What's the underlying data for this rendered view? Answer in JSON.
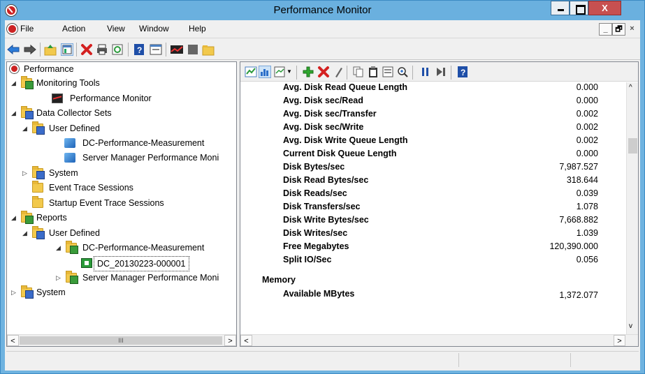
{
  "window": {
    "title": "Performance Monitor",
    "close_label": "X"
  },
  "menu": {
    "items": [
      "File",
      "Action",
      "View",
      "Window",
      "Help"
    ],
    "mdi": {
      "minimize": "_",
      "restore": "🗗",
      "close": "×"
    }
  },
  "toolbar": {
    "icons": [
      "back-arrow-icon",
      "forward-arrow-icon",
      "up-folder-icon",
      "show-hide-console-tree-icon",
      "delete-icon",
      "print-icon",
      "refresh-icon",
      "help-icon",
      "properties-icon",
      "performance-chart-icon",
      "stop-icon",
      "new-folder-icon"
    ]
  },
  "tree": {
    "root": "Performance",
    "nodes": [
      {
        "label": "Monitoring Tools"
      },
      {
        "label": "Performance Monitor"
      },
      {
        "label": "Data Collector Sets"
      },
      {
        "label": "User Defined"
      },
      {
        "label": "DC-Performance-Measurement"
      },
      {
        "label": "Server Manager Performance Moni"
      },
      {
        "label": "System"
      },
      {
        "label": "Event Trace Sessions"
      },
      {
        "label": "Startup Event Trace Sessions"
      },
      {
        "label": "Reports"
      },
      {
        "label": "User Defined"
      },
      {
        "label": "DC-Performance-Measurement"
      },
      {
        "label": "DC_20130223-000001"
      },
      {
        "label": "Server Manager Performance Moni"
      },
      {
        "label": "System"
      }
    ],
    "scroll_thumb_label": "III"
  },
  "report": {
    "counters": [
      {
        "name": "Avg. Disk Read Queue Length",
        "value": "0.000"
      },
      {
        "name": "Avg. Disk sec/Read",
        "value": "0.000"
      },
      {
        "name": "Avg. Disk sec/Transfer",
        "value": "0.002"
      },
      {
        "name": "Avg. Disk sec/Write",
        "value": "0.002"
      },
      {
        "name": "Avg. Disk Write Queue Length",
        "value": "0.002"
      },
      {
        "name": "Current Disk Queue Length",
        "value": "0.000"
      },
      {
        "name": "Disk Bytes/sec",
        "value": "7,987.527"
      },
      {
        "name": "Disk Read Bytes/sec",
        "value": "318.644"
      },
      {
        "name": "Disk Reads/sec",
        "value": "0.039"
      },
      {
        "name": "Disk Transfers/sec",
        "value": "1.078"
      },
      {
        "name": "Disk Write Bytes/sec",
        "value": "7,668.882"
      },
      {
        "name": "Disk Writes/sec",
        "value": "1.039"
      },
      {
        "name": "Free Megabytes",
        "value": "120,390.000"
      },
      {
        "name": "Split IO/Sec",
        "value": "0.056"
      }
    ],
    "memory_section": "Memory",
    "memory_counters": [
      {
        "name": "Available MBytes",
        "value": "1,372.077"
      }
    ]
  },
  "scroll": {
    "up": "^",
    "down": "v",
    "left": "<",
    "right": ">"
  }
}
